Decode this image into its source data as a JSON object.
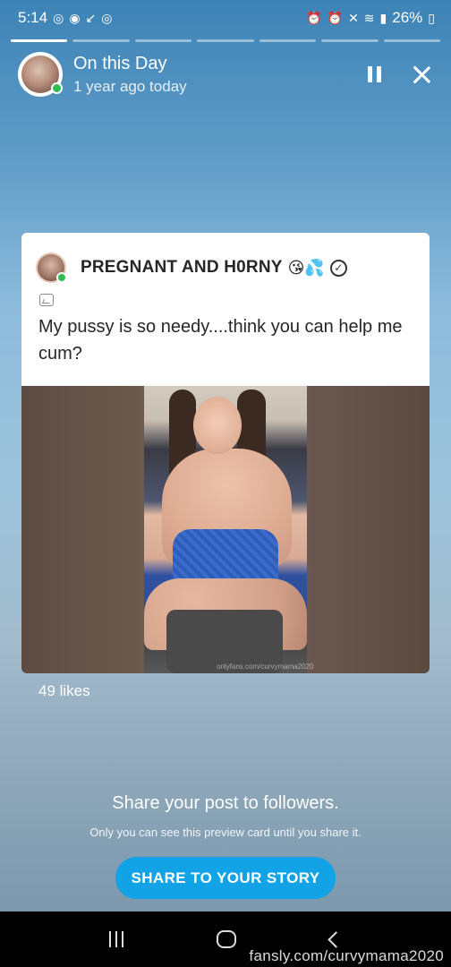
{
  "status_bar": {
    "time": "5:14",
    "battery": "26%",
    "left_icons": [
      "instagram-icon",
      "chrome-icon",
      "missed-call-icon",
      "instagram-icon"
    ],
    "right_icons": [
      "alarm-icon",
      "alarm-icon",
      "mute-icon",
      "wifi-icon",
      "signal-icon",
      "battery-icon"
    ]
  },
  "story": {
    "progress_segments": 7,
    "active_segment": 0,
    "title": "On this Day",
    "subtitle": "1 year ago today"
  },
  "post": {
    "author": "PREGNANT AND H0RNY",
    "author_emojis": "😘💦",
    "text": "My pussy is so needy....think you can help me cum?",
    "media_watermark": "onlyfans.com/curvymama2020",
    "likes": "49 likes"
  },
  "share": {
    "title": "Share your post to followers.",
    "note": "Only you can see this preview card until you share it.",
    "button_label": "SHARE TO YOUR STORY"
  },
  "watermark": "fansly.com/curvymama2020",
  "colors": {
    "accent": "#12a2e6",
    "online": "#2ebd4e"
  }
}
